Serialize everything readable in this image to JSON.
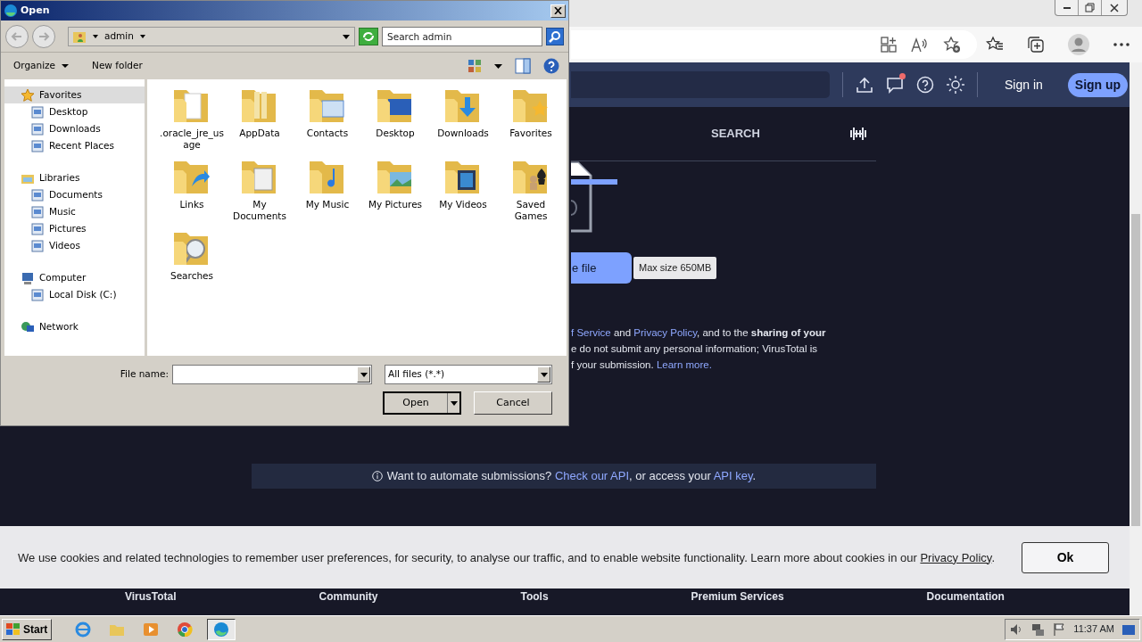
{
  "browser": {
    "site_header": {
      "notification_dot": true,
      "sign_in": "Sign in",
      "sign_up": "Sign up"
    },
    "tabs": [
      {
        "label": "SEARCH",
        "selected": false
      }
    ],
    "upload_button": "e file",
    "max_size": "Max size 650MB",
    "terms_lines": [
      [
        {
          "kind": "link",
          "text": "f Service"
        },
        {
          "kind": "text",
          "text": " and "
        },
        {
          "kind": "link",
          "text": "Privacy Policy"
        },
        {
          "kind": "text",
          "text": ", and to the **sharing of your**"
        }
      ],
      [
        {
          "kind": "text",
          "text": "e do not submit any personal information; VirusTotal is"
        }
      ],
      [
        {
          "kind": "text",
          "text": "f your submission. "
        },
        {
          "kind": "link",
          "text": "Learn more."
        }
      ]
    ],
    "api_banner": [
      {
        "kind": "text",
        "text": "Want to automate submissions? "
      },
      {
        "kind": "link",
        "text": "Check our API"
      },
      {
        "kind": "text",
        "text": ", or access your "
      },
      {
        "kind": "link",
        "text": "API key"
      },
      {
        "kind": "text",
        "text": "."
      }
    ],
    "cookie_banner": {
      "text": [
        {
          "kind": "text",
          "text": "We use cookies and related technologies to remember user preferences, for security, to analyse our traffic, and to enable website functionality. Learn more about cookies in our "
        },
        {
          "kind": "link",
          "text": "Privacy Policy"
        },
        {
          "kind": "text",
          "text": "."
        }
      ],
      "ok": "Ok"
    },
    "footer_links": [
      "VirusTotal",
      "Community",
      "Tools",
      "Premium Services",
      "Documentation"
    ]
  },
  "dialog": {
    "title": "Open",
    "location": "admin",
    "search_placeholder": "Search admin",
    "commands": [
      {
        "label": "Organize",
        "kind": "menu"
      },
      {
        "label": "New folder",
        "kind": "button"
      }
    ],
    "nav": [
      {
        "label": "Favorites",
        "selected": true,
        "children": [
          {
            "label": "Desktop",
            "selected": false
          },
          {
            "label": "Downloads",
            "selected": false
          },
          {
            "label": "Recent Places",
            "selected": false
          }
        ]
      },
      {
        "label": "Libraries",
        "selected": false,
        "children": [
          {
            "label": "Documents",
            "selected": false
          },
          {
            "label": "Music",
            "selected": false
          },
          {
            "label": "Pictures",
            "selected": false
          },
          {
            "label": "Videos",
            "selected": false
          }
        ]
      },
      {
        "label": "Computer",
        "selected": false,
        "children": [
          {
            "label": "Local Disk (C:)",
            "selected": false
          }
        ]
      },
      {
        "label": "Network",
        "selected": false
      }
    ],
    "files": [
      {
        "name": ".oracle_jre_usage"
      },
      {
        "name": "AppData"
      },
      {
        "name": "Contacts"
      },
      {
        "name": "Desktop"
      },
      {
        "name": "Downloads"
      },
      {
        "name": "Favorites"
      },
      {
        "name": "Links"
      },
      {
        "name": "My Documents"
      },
      {
        "name": "My Music"
      },
      {
        "name": "My Pictures"
      },
      {
        "name": "My Videos"
      },
      {
        "name": "Saved Games"
      },
      {
        "name": "Searches"
      }
    ],
    "file_name_label": "File name:",
    "file_type": "All files (*.*)",
    "open": "Open",
    "cancel": "Cancel"
  },
  "taskbar": {
    "start": "Start",
    "apps": [
      {
        "selected": false
      },
      {
        "selected": false
      },
      {
        "selected": false
      },
      {
        "selected": false
      },
      {
        "selected": true
      }
    ],
    "clock": "11:37 AM"
  }
}
